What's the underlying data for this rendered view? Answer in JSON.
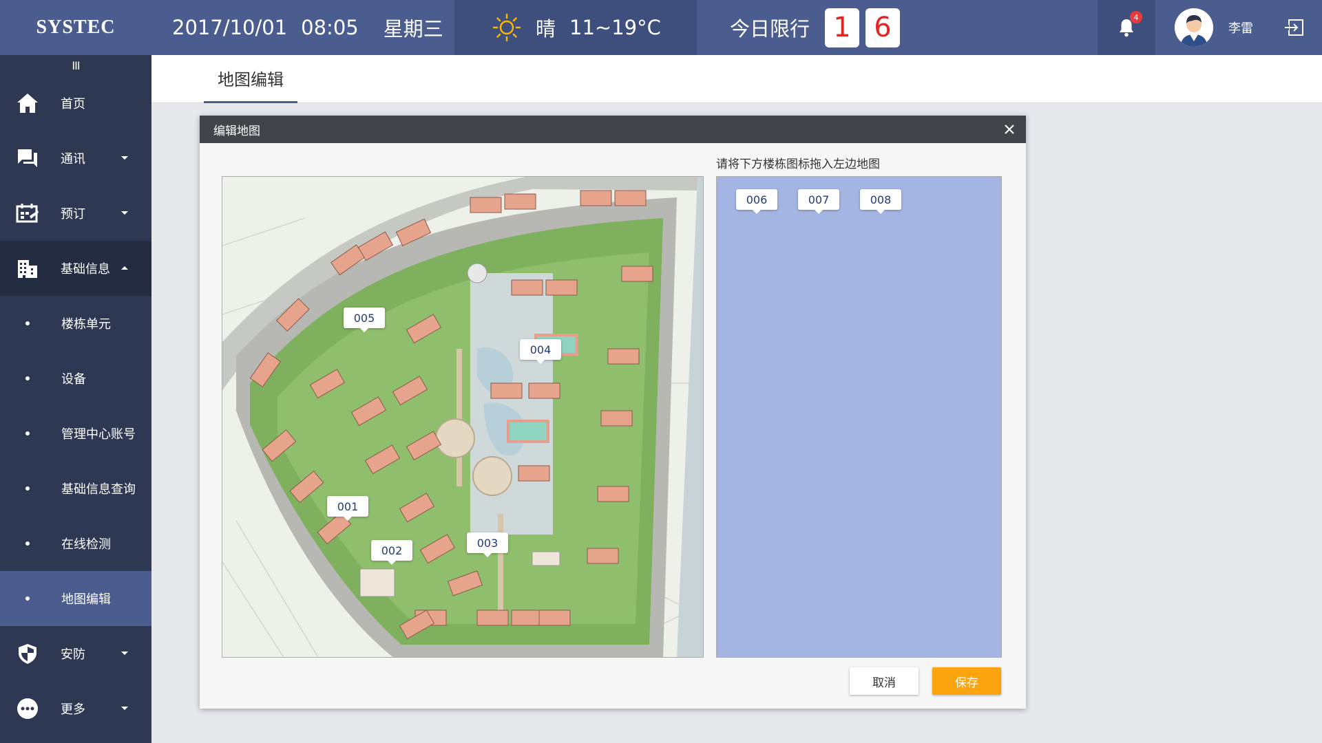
{
  "header": {
    "logo": "SYSTEC",
    "date": "2017/10/01",
    "time": "08:05",
    "weekday": "星期三",
    "weather_text": "晴",
    "temperature": "11~19°C",
    "limit_label": "今日限行",
    "limit_digits": [
      "1",
      "6"
    ],
    "notification_count": "4",
    "username": "李雷",
    "icons": {
      "weather": "sun-icon",
      "notification": "bell-icon",
      "logout": "logout-icon"
    }
  },
  "sidebar": {
    "collapse_label": "III",
    "items": [
      {
        "label": "首页",
        "icon": "home-icon"
      },
      {
        "label": "通讯",
        "icon": "chat-icon"
      },
      {
        "label": "预订",
        "icon": "booking-icon"
      },
      {
        "label": "基础信息",
        "icon": "building-icon"
      },
      {
        "label": "楼栋单元"
      },
      {
        "label": "设备"
      },
      {
        "label": "管理中心账号"
      },
      {
        "label": "基础信息查询"
      },
      {
        "label": "在线检测"
      },
      {
        "label": "地图编辑"
      },
      {
        "label": "安防",
        "icon": "shield-icon"
      },
      {
        "label": "更多",
        "icon": "more-icon"
      }
    ]
  },
  "tabs": {
    "active": "地图编辑"
  },
  "dialog": {
    "title": "编辑地图",
    "hint": "请将下方楼栋图标拖入左边地图",
    "map_markers": [
      "005",
      "004",
      "001",
      "002",
      "003"
    ],
    "pending_markers": [
      "006",
      "007",
      "008"
    ],
    "cancel_label": "取消",
    "save_label": "保存"
  },
  "colors": {
    "topbar": "#4a5d8e",
    "sidebar": "#2e3852",
    "accent": "#fba40e",
    "dropzone": "#a4b5e4",
    "dialog_header": "#414549"
  }
}
